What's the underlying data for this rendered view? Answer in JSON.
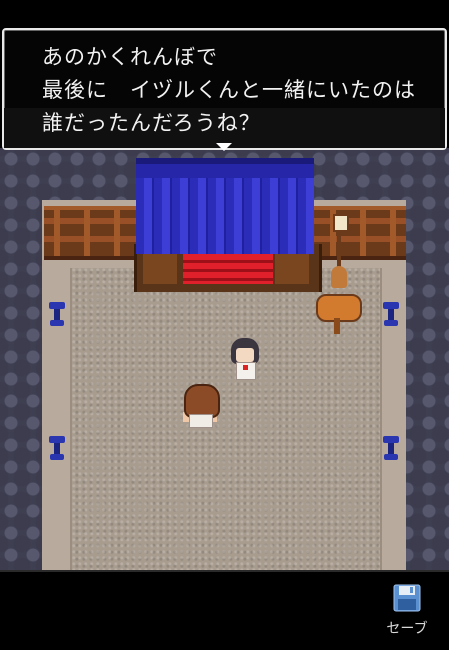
{
  "dialog": {
    "line1": "あのかくれんぼで",
    "line2": "最後に　イヅルくんと一緒にいたのは",
    "line3": "誰だったんだろうね？"
  },
  "toolbar": {
    "save_label": "セーブ",
    "save_icon": "floppy-disk-icon"
  },
  "colors": {
    "dialog_bg": "#050505",
    "dialog_border": "#e9e9e9",
    "curtain": "#2b2cb8",
    "stage_red": "#e0202a",
    "save_icon": "#5a8fd0"
  }
}
